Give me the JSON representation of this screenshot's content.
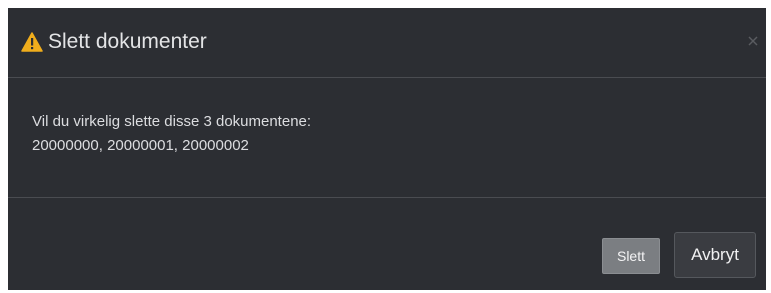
{
  "dialog": {
    "title": "Slett dokumenter",
    "icons": {
      "title_icon": "warning-icon",
      "close": "close-icon"
    },
    "message_line1": "Vil du virkelig slette disse 3 dokumentene:",
    "message_line2": "20000000, 20000001, 20000002",
    "buttons": {
      "delete_label": "Slett",
      "cancel_label": "Avbryt"
    }
  },
  "colors": {
    "dialog_background": "#2c2e33",
    "warning": "#f0ad1c",
    "divider": "#4a4c51",
    "delete_button": "#7b7e82",
    "cancel_button": "#3a3c41"
  }
}
